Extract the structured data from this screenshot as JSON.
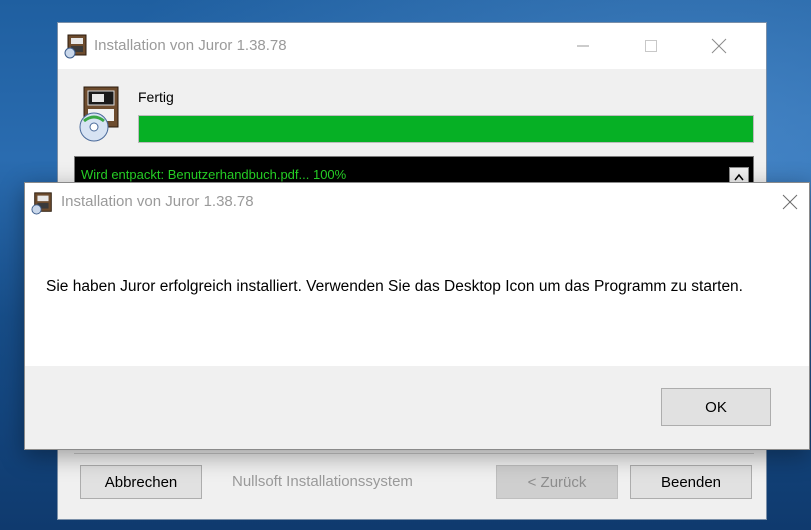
{
  "installer": {
    "title": "Installation von Juror 1.38.78",
    "status_label": "Fertig",
    "progress_percent": 100,
    "log_line": "Wird entpackt: Benutzerhandbuch.pdf... 100%",
    "buttons": {
      "cancel": "Abbrechen",
      "back": "< Zurück",
      "finish": "Beenden"
    },
    "brand": "Nullsoft Installationssystem"
  },
  "dialog": {
    "title": "Installation von Juror 1.38.78",
    "message": "Sie haben Juror erfolgreich installiert. Verwenden Sie das Desktop Icon um das Programm zu starten.",
    "ok": "OK"
  },
  "colors": {
    "progress": "#06b025",
    "log_text": "#27d627"
  },
  "icons": [
    "installer-app-icon",
    "minimize-icon",
    "maximize-icon",
    "close-icon",
    "installer-disc-icon",
    "scroll-up-icon"
  ]
}
